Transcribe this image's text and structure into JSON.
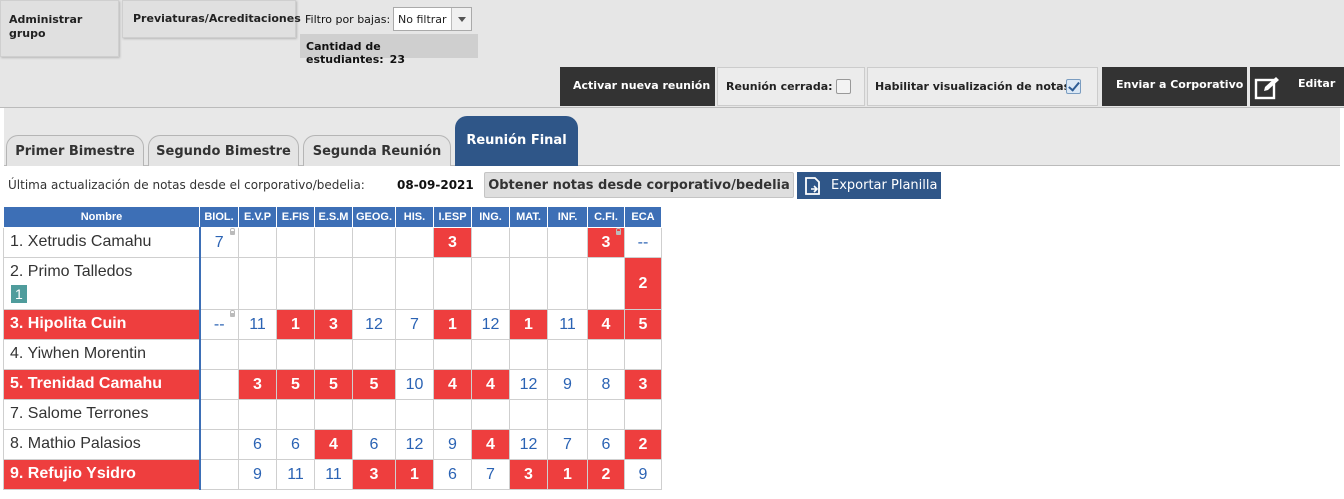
{
  "top": {
    "admin_label": "Administrar grupo",
    "previat_label": "Previaturas/Acreditaciones",
    "filter_label": "Filtro por bajas:",
    "filter_value": "No filtrar",
    "count_label": "Cantidad de estudiantes:",
    "count_value": "23"
  },
  "actions": {
    "activar": "Activar nueva reunión",
    "cerrada": "Reunión cerrada:",
    "habilitar": "Habilitar visualización de notas",
    "enviar": "Enviar a Corporativo",
    "editar": "Editar"
  },
  "tabs": [
    "Primer Bimestre",
    "Segundo Bimestre",
    "Segunda Reunión",
    "Reunión Final"
  ],
  "update": {
    "label": "Última actualización de notas desde el corporativo/bedelia:",
    "date": "08-09-2021",
    "obtener": "Obtener notas desde corporativo/bedelia",
    "exportar": "Exportar Planilla"
  },
  "grid": {
    "headers": [
      "Nombre",
      "BIOL.",
      "E.V.P",
      "E.FIS",
      "E.S.M",
      "GEOG.",
      "HIS.",
      "I.ESP",
      "ING.",
      "MAT.",
      "INF.",
      "C.FI.",
      "ECA"
    ],
    "rows": [
      {
        "name": "1. Xetrudis Camahu",
        "fail": false,
        "cells": [
          {
            "v": "7",
            "f": false,
            "l": true
          },
          {
            "v": "",
            "f": false
          },
          {
            "v": "",
            "f": false
          },
          {
            "v": "",
            "f": false
          },
          {
            "v": "",
            "f": false
          },
          {
            "v": "",
            "f": false
          },
          {
            "v": "3",
            "f": true
          },
          {
            "v": "",
            "f": false
          },
          {
            "v": "",
            "f": false
          },
          {
            "v": "",
            "f": false
          },
          {
            "v": "3",
            "f": true,
            "l": true
          },
          {
            "v": "--",
            "f": false
          }
        ]
      },
      {
        "name": "2. Primo Talledos",
        "badge": "1",
        "fail": false,
        "tall": true,
        "cells": [
          {
            "v": "",
            "f": false
          },
          {
            "v": "",
            "f": false
          },
          {
            "v": "",
            "f": false
          },
          {
            "v": "",
            "f": false
          },
          {
            "v": "",
            "f": false
          },
          {
            "v": "",
            "f": false
          },
          {
            "v": "",
            "f": false
          },
          {
            "v": "",
            "f": false
          },
          {
            "v": "",
            "f": false
          },
          {
            "v": "",
            "f": false
          },
          {
            "v": "",
            "f": false
          },
          {
            "v": "2",
            "f": true
          }
        ]
      },
      {
        "name": "3. Hipolita Cuin",
        "fail": true,
        "cells": [
          {
            "v": "--",
            "f": false,
            "l": true
          },
          {
            "v": "11",
            "f": false
          },
          {
            "v": "1",
            "f": true
          },
          {
            "v": "3",
            "f": true
          },
          {
            "v": "12",
            "f": false
          },
          {
            "v": "7",
            "f": false
          },
          {
            "v": "1",
            "f": true
          },
          {
            "v": "12",
            "f": false
          },
          {
            "v": "1",
            "f": true
          },
          {
            "v": "11",
            "f": false
          },
          {
            "v": "4",
            "f": true
          },
          {
            "v": "5",
            "f": true
          }
        ]
      },
      {
        "name": "4. Yiwhen Morentin",
        "fail": false,
        "cells": [
          {
            "v": "",
            "f": false
          },
          {
            "v": "",
            "f": false
          },
          {
            "v": "",
            "f": false
          },
          {
            "v": "",
            "f": false
          },
          {
            "v": "",
            "f": false
          },
          {
            "v": "",
            "f": false
          },
          {
            "v": "",
            "f": false
          },
          {
            "v": "",
            "f": false
          },
          {
            "v": "",
            "f": false
          },
          {
            "v": "",
            "f": false
          },
          {
            "v": "",
            "f": false
          },
          {
            "v": "",
            "f": false
          }
        ]
      },
      {
        "name": "5. Trenidad Camahu",
        "fail": true,
        "cells": [
          {
            "v": "",
            "f": false
          },
          {
            "v": "3",
            "f": true
          },
          {
            "v": "5",
            "f": true
          },
          {
            "v": "5",
            "f": true
          },
          {
            "v": "5",
            "f": true
          },
          {
            "v": "10",
            "f": false
          },
          {
            "v": "4",
            "f": true
          },
          {
            "v": "4",
            "f": true
          },
          {
            "v": "12",
            "f": false
          },
          {
            "v": "9",
            "f": false
          },
          {
            "v": "8",
            "f": false
          },
          {
            "v": "3",
            "f": true
          }
        ]
      },
      {
        "name": "7. Salome Terrones",
        "fail": false,
        "cells": [
          {
            "v": "",
            "f": false
          },
          {
            "v": "",
            "f": false
          },
          {
            "v": "",
            "f": false
          },
          {
            "v": "",
            "f": false
          },
          {
            "v": "",
            "f": false
          },
          {
            "v": "",
            "f": false
          },
          {
            "v": "",
            "f": false
          },
          {
            "v": "",
            "f": false
          },
          {
            "v": "",
            "f": false
          },
          {
            "v": "",
            "f": false
          },
          {
            "v": "",
            "f": false
          },
          {
            "v": "",
            "f": false
          }
        ]
      },
      {
        "name": "8. Mathio Palasios",
        "fail": false,
        "cells": [
          {
            "v": "",
            "f": false
          },
          {
            "v": "6",
            "f": false
          },
          {
            "v": "6",
            "f": false
          },
          {
            "v": "4",
            "f": true
          },
          {
            "v": "6",
            "f": false
          },
          {
            "v": "12",
            "f": false
          },
          {
            "v": "9",
            "f": false
          },
          {
            "v": "4",
            "f": true
          },
          {
            "v": "12",
            "f": false
          },
          {
            "v": "7",
            "f": false
          },
          {
            "v": "6",
            "f": false
          },
          {
            "v": "2",
            "f": true
          }
        ]
      },
      {
        "name": "9. Refujio Ysidro",
        "fail": true,
        "cells": [
          {
            "v": "",
            "f": false
          },
          {
            "v": "9",
            "f": false
          },
          {
            "v": "11",
            "f": false
          },
          {
            "v": "11",
            "f": false
          },
          {
            "v": "3",
            "f": true
          },
          {
            "v": "1",
            "f": true
          },
          {
            "v": "6",
            "f": false
          },
          {
            "v": "7",
            "f": false
          },
          {
            "v": "3",
            "f": true
          },
          {
            "v": "1",
            "f": true
          },
          {
            "v": "2",
            "f": true
          },
          {
            "v": "9",
            "f": false
          }
        ]
      }
    ]
  }
}
